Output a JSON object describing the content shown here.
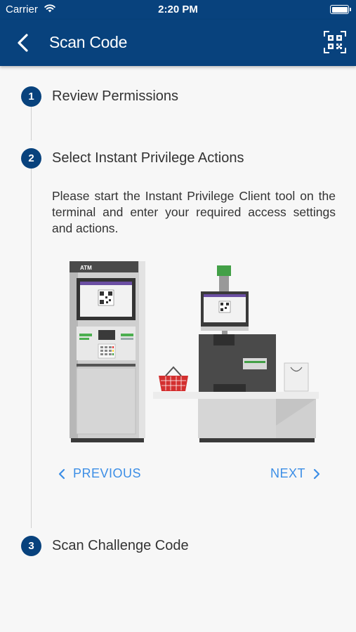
{
  "status_bar": {
    "carrier": "Carrier",
    "time": "2:20 PM"
  },
  "header": {
    "title": "Scan Code",
    "back_icon": "chevron-left-icon",
    "action_icon": "qr-scan-icon"
  },
  "steps": [
    {
      "number": "1",
      "label": "Review Permissions"
    },
    {
      "number": "2",
      "label": "Select Instant Privilege Actions"
    },
    {
      "number": "3",
      "label": "Scan Challenge Code"
    }
  ],
  "active_step": {
    "description": "Please start the Instant Privilege Client tool on the terminal and enter your required access settings and actions.",
    "illustration": {
      "atm_label": "ATM"
    }
  },
  "navigation": {
    "previous_label": "PREVIOUS",
    "next_label": "NEXT"
  },
  "colors": {
    "brand": "#08427d",
    "link": "#3c8ee6",
    "text": "#333333",
    "background": "#f7f7f7"
  }
}
